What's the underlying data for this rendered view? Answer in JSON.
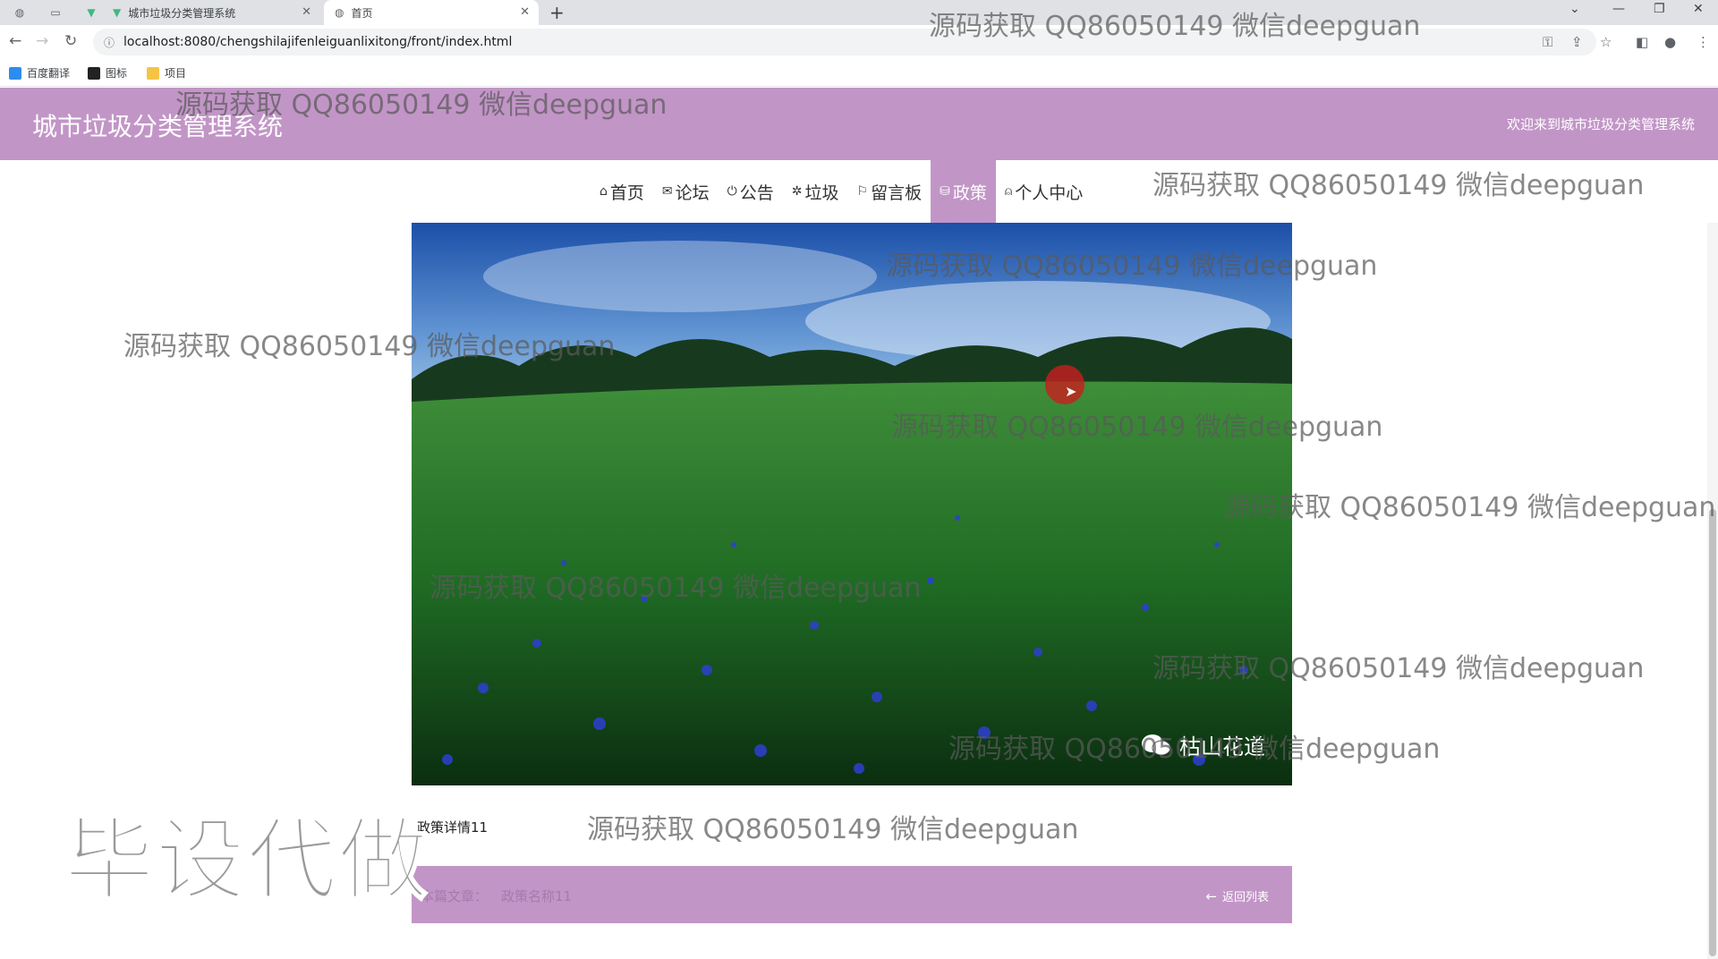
{
  "browser": {
    "tabs": [
      {
        "title": "城市垃圾分类管理系统",
        "active": false
      },
      {
        "title": "首页",
        "active": true
      }
    ],
    "url": "localhost:8080/chengshilajifenleiguanlixitong/front/index.html",
    "bookmarks": [
      "百度翻译",
      "图标",
      "项目"
    ]
  },
  "header": {
    "title": "城市垃圾分类管理系统",
    "welcome": "欢迎来到城市垃圾分类管理系统"
  },
  "nav": {
    "items": [
      {
        "label": "首页",
        "icon": "home-icon",
        "glyph": "⌂"
      },
      {
        "label": "论坛",
        "icon": "mail-icon",
        "glyph": "✉"
      },
      {
        "label": "公告",
        "icon": "power-icon",
        "glyph": "⏻"
      },
      {
        "label": "垃圾",
        "icon": "gear-icon",
        "glyph": "✲"
      },
      {
        "label": "留言板",
        "icon": "flag-icon",
        "glyph": "⚐"
      },
      {
        "label": "政策",
        "icon": "database-icon",
        "glyph": "⛁"
      },
      {
        "label": "个人中心",
        "icon": "user-icon",
        "glyph": "⍝"
      }
    ],
    "active": "政策"
  },
  "banner": {
    "caption": "枯山花道"
  },
  "detail_text": "政策详情11",
  "footer": {
    "article_label": "本篇文章：",
    "article_title": "政策名称11",
    "back_label": "返回列表"
  },
  "watermark": {
    "text": "源码获取 QQ86050149 微信deepguan",
    "big": "毕设代做"
  },
  "colors": {
    "accent": "#c295c7",
    "header_text": "#ffffff"
  }
}
